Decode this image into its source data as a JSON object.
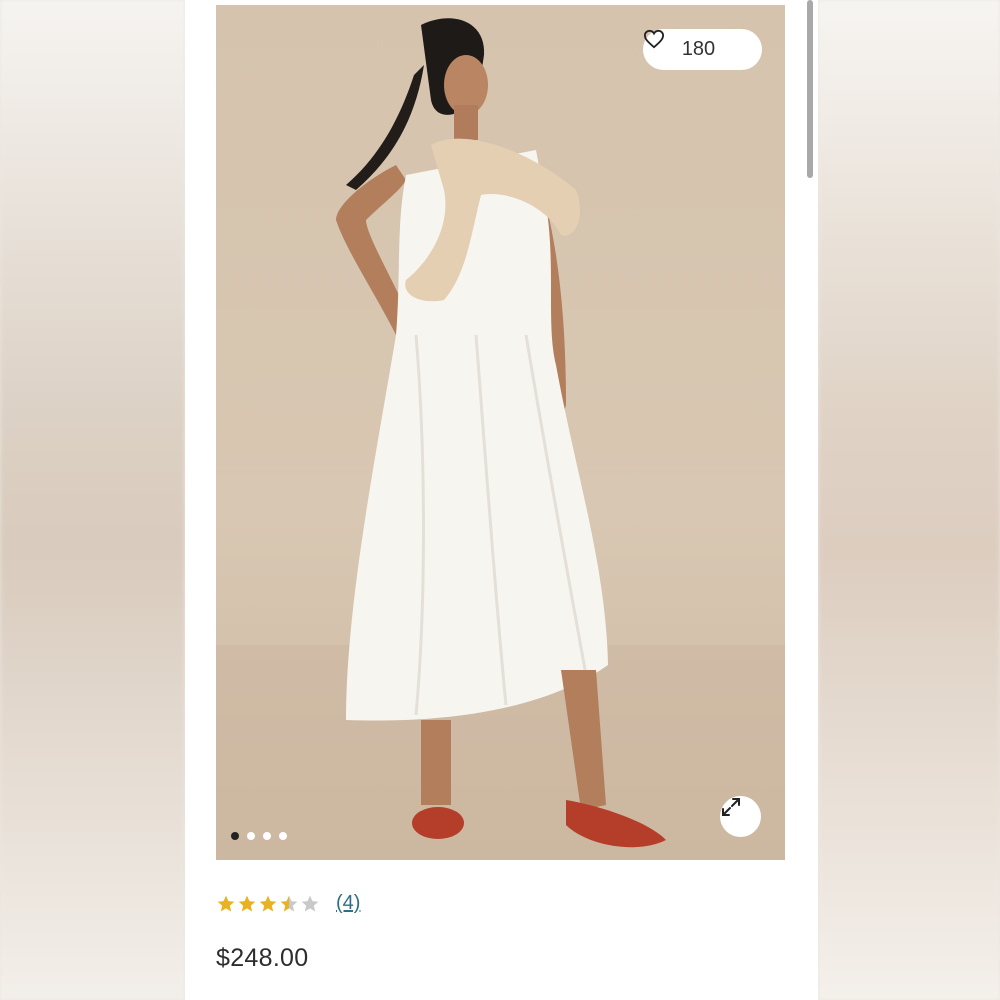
{
  "product": {
    "like_count": "180",
    "rating_value": 3.5,
    "rating_max": 5,
    "review_count": "(4)",
    "price": "$248.00",
    "carousel": {
      "total": 4,
      "active": 1
    }
  },
  "icons": {
    "like": "heart-icon",
    "expand": "expand-icon",
    "star": "star-icon"
  },
  "colors": {
    "star_fill": "#e8b223",
    "star_empty": "#c9c9c9",
    "link": "#2f6e88",
    "image_bg": "#d5c3ad"
  }
}
